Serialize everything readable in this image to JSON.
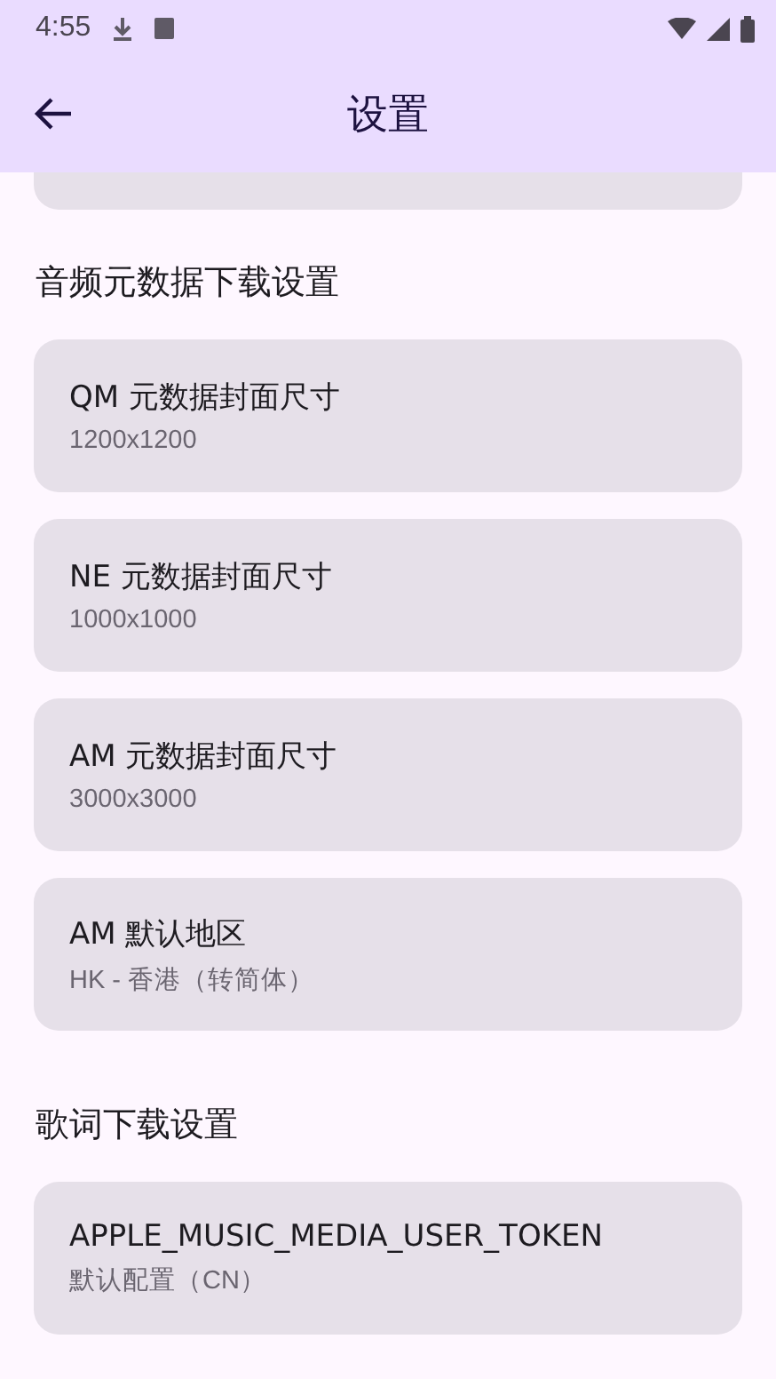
{
  "status_bar": {
    "time": "4:55"
  },
  "app_bar": {
    "title": "设置"
  },
  "sections": [
    {
      "title": "音频元数据下载设置",
      "items": [
        {
          "title": "QM 元数据封面尺寸",
          "value": "1200x1200"
        },
        {
          "title": "NE 元数据封面尺寸",
          "value": "1000x1000"
        },
        {
          "title": "AM 元数据封面尺寸",
          "value": "3000x3000"
        },
        {
          "title": "AM 默认地区",
          "value": "HK - 香港（转简体）"
        }
      ]
    },
    {
      "title": "歌词下载设置",
      "items": [
        {
          "title": "APPLE_MUSIC_MEDIA_USER_TOKEN",
          "value": "默认配置（CN）"
        }
      ]
    }
  ]
}
